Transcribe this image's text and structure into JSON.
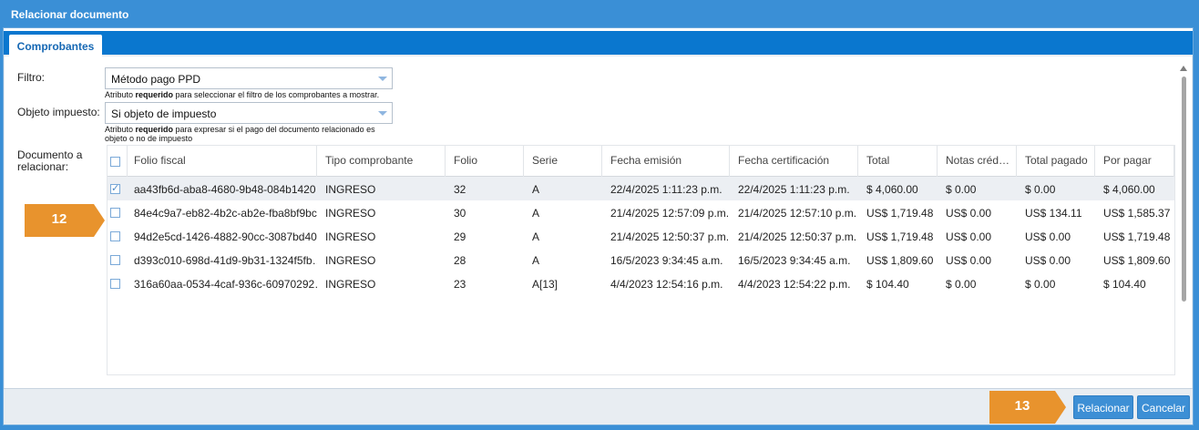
{
  "window": {
    "title": "Relacionar documento"
  },
  "tabs": [
    {
      "label": "Comprobantes"
    }
  ],
  "form": {
    "filtro_label": "Filtro:",
    "filtro_value": "Método pago PPD",
    "filtro_hint_pre": "Atributo ",
    "filtro_hint_bold": "requerido",
    "filtro_hint_post": " para seleccionar el filtro de los comprobantes a mostrar.",
    "objeto_label": "Objeto impuesto:",
    "objeto_value": "Si objeto de impuesto",
    "objeto_hint_pre": "Atributo ",
    "objeto_hint_bold": "requerido",
    "objeto_hint_post": " para expresar si el pago del documento relacionado es objeto o no de impuesto",
    "documento_label_1": "Documento a",
    "documento_label_2": "relacionar:"
  },
  "table": {
    "columns": [
      "Folio fiscal",
      "Tipo comprobante",
      "Folio",
      "Serie",
      "Fecha emisión",
      "Fecha certificación",
      "Total",
      "Notas créd…",
      "Total pagado",
      "Por pagar"
    ],
    "rows": [
      {
        "checked": true,
        "cells": [
          "aa43fb6d-aba8-4680-9b48-084b1420…",
          "INGRESO",
          "32",
          "A",
          "22/4/2025 1:11:23 p.m.",
          "22/4/2025 1:11:23 p.m.",
          "$ 4,060.00",
          "$ 0.00",
          "$ 0.00",
          "$ 4,060.00"
        ]
      },
      {
        "checked": false,
        "cells": [
          "84e4c9a7-eb82-4b2c-ab2e-fba8bf9bc…",
          "INGRESO",
          "30",
          "A",
          "21/4/2025 12:57:09 p.m.",
          "21/4/2025 12:57:10 p.m.",
          "US$ 1,719.48",
          "US$ 0.00",
          "US$ 134.11",
          "US$ 1,585.37"
        ]
      },
      {
        "checked": false,
        "cells": [
          "94d2e5cd-1426-4882-90cc-3087bd40…",
          "INGRESO",
          "29",
          "A",
          "21/4/2025 12:50:37 p.m.",
          "21/4/2025 12:50:37 p.m.",
          "US$ 1,719.48",
          "US$ 0.00",
          "US$ 0.00",
          "US$ 1,719.48"
        ]
      },
      {
        "checked": false,
        "cells": [
          "d393c010-698d-41d9-9b31-1324f5fb…",
          "INGRESO",
          "28",
          "A",
          "16/5/2023 9:34:45 a.m.",
          "16/5/2023 9:34:45 a.m.",
          "US$ 1,809.60",
          "US$ 0.00",
          "US$ 0.00",
          "US$ 1,809.60"
        ]
      },
      {
        "checked": false,
        "cells": [
          "316a60aa-0534-4caf-936c-60970292…",
          "INGRESO",
          "23",
          "A[13]",
          "4/4/2023 12:54:16 p.m.",
          "4/4/2023 12:54:22 p.m.",
          "$ 104.40",
          "$ 0.00",
          "$ 0.00",
          "$ 104.40"
        ]
      }
    ]
  },
  "callouts": {
    "step_12": "12",
    "step_13": "13",
    "color": "#e8932d"
  },
  "buttons": {
    "relacionar": "Relacionar",
    "cancelar": "Cancelar"
  },
  "colors": {
    "header_blue": "#3a8fd6",
    "tab_strip": "#0a77cf",
    "button_blue": "#3d8fd5"
  }
}
